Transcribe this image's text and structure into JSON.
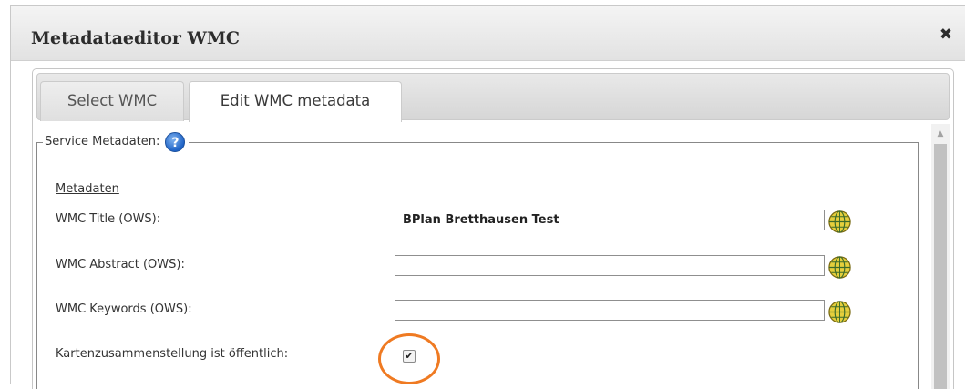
{
  "dialog": {
    "title": "Metadataeditor WMC",
    "close_glyph": "✖"
  },
  "tabs": [
    {
      "label": "Select WMC",
      "active": false
    },
    {
      "label": "Edit WMC metadata",
      "active": true
    }
  ],
  "fieldset": {
    "legend": "Service Metadaten:",
    "help_glyph": "?",
    "help_icon": "help-icon"
  },
  "form": {
    "section_heading": "Metadaten",
    "title_label": "WMC Title (OWS):",
    "title_value": "BPlan Bretthausen Test",
    "abstract_label": "WMC Abstract (OWS):",
    "abstract_value": "",
    "keywords_label": "WMC Keywords (OWS):",
    "keywords_value": "",
    "public_label": "Kartenzusammenstellung ist öffentlich:",
    "public_checked": true,
    "checkbox_glyph": "✔"
  },
  "icons": {
    "globe": "globe-icon",
    "close": "close-icon"
  },
  "colors": {
    "highlight": "#ef7a22",
    "help_blue": "#1f63c6",
    "globe_yellow": "#e5cf3c"
  }
}
